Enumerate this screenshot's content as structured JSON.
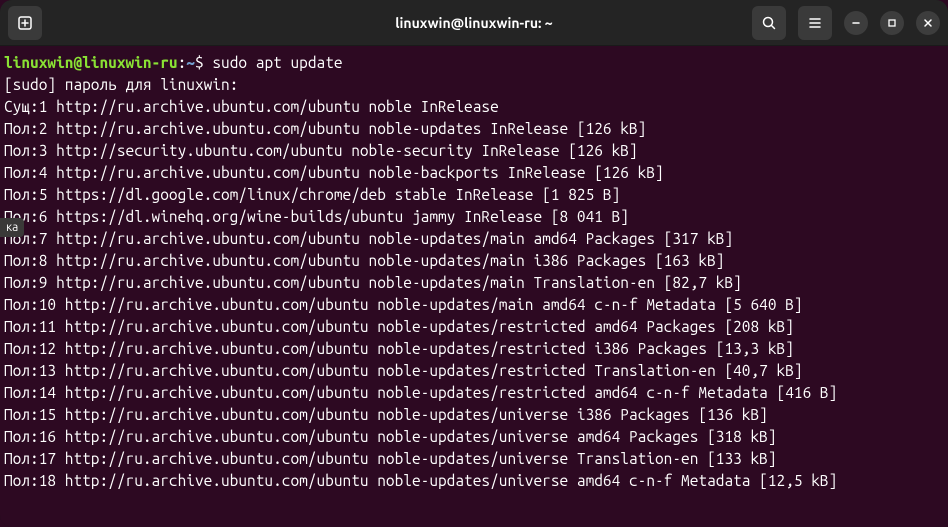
{
  "titlebar": {
    "title": "linuxwin@linuxwin-ru: ~"
  },
  "sideTab": "ка",
  "prompt": {
    "user": "linuxwin@linuxwin-ru",
    "path": "~",
    "command": "sudo apt update"
  },
  "sudoLine": "[sudo] пароль для linuxwin:",
  "lines": [
    "Сущ:1 http://ru.archive.ubuntu.com/ubuntu noble InRelease",
    "Пол:2 http://ru.archive.ubuntu.com/ubuntu noble-updates InRelease [126 kB]",
    "Пол:3 http://security.ubuntu.com/ubuntu noble-security InRelease [126 kB]",
    "Пол:4 http://ru.archive.ubuntu.com/ubuntu noble-backports InRelease [126 kB]",
    "Пол:5 https://dl.google.com/linux/chrome/deb stable InRelease [1 825 B]",
    "Пол:6 https://dl.winehq.org/wine-builds/ubuntu jammy InRelease [8 041 B]",
    "Пол:7 http://ru.archive.ubuntu.com/ubuntu noble-updates/main amd64 Packages [317 kB]",
    "Пол:8 http://ru.archive.ubuntu.com/ubuntu noble-updates/main i386 Packages [163 kB]",
    "Пол:9 http://ru.archive.ubuntu.com/ubuntu noble-updates/main Translation-en [82,7 kB]",
    "Пол:10 http://ru.archive.ubuntu.com/ubuntu noble-updates/main amd64 c-n-f Metadata [5 640 B]",
    "Пол:11 http://ru.archive.ubuntu.com/ubuntu noble-updates/restricted amd64 Packages [208 kB]",
    "Пол:12 http://ru.archive.ubuntu.com/ubuntu noble-updates/restricted i386 Packages [13,3 kB]",
    "Пол:13 http://ru.archive.ubuntu.com/ubuntu noble-updates/restricted Translation-en [40,7 kB]",
    "Пол:14 http://ru.archive.ubuntu.com/ubuntu noble-updates/restricted amd64 c-n-f Metadata [416 B]",
    "Пол:15 http://ru.archive.ubuntu.com/ubuntu noble-updates/universe i386 Packages [136 kB]",
    "Пол:16 http://ru.archive.ubuntu.com/ubuntu noble-updates/universe amd64 Packages [318 kB]",
    "Пол:17 http://ru.archive.ubuntu.com/ubuntu noble-updates/universe Translation-en [133 kB]",
    "Пол:18 http://ru.archive.ubuntu.com/ubuntu noble-updates/universe amd64 c-n-f Metadata [12,5 kB]"
  ]
}
